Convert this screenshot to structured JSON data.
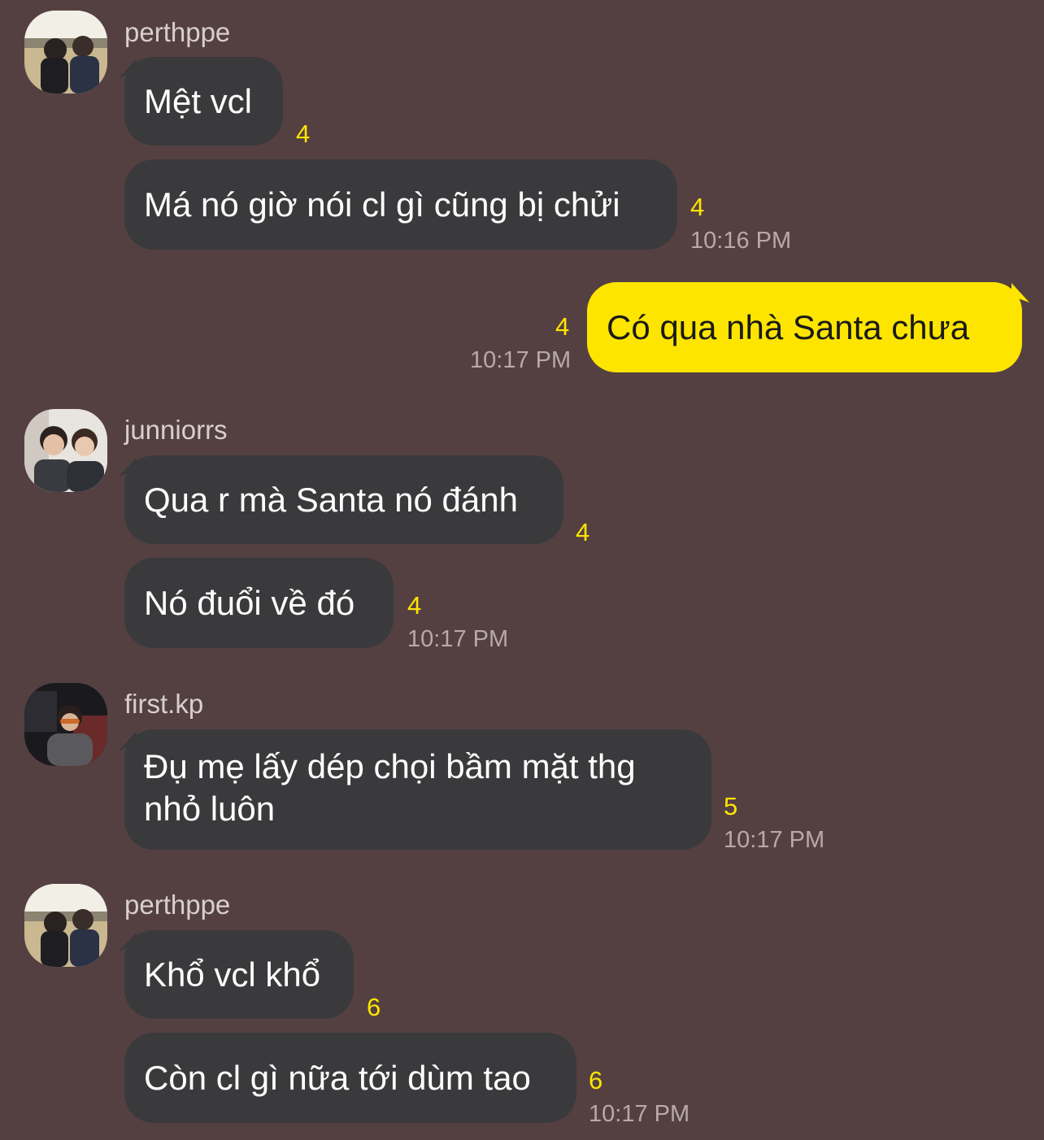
{
  "colors": {
    "background": "#554041",
    "incoming_bubble": "#3a3a3c",
    "outgoing_bubble": "#fee500",
    "unread_count": "#fee500",
    "timestamp": "#b8a9a9",
    "sender_name": "#d8cfcf"
  },
  "groups": [
    {
      "sender": "perthppe",
      "messages": [
        {
          "text": "Mệt vcl",
          "unread": "4",
          "time": ""
        },
        {
          "text": "Má nó giờ nói cl gì cũng bị chửi",
          "unread": "4",
          "time": "10:16 PM"
        }
      ]
    },
    {
      "sender": "me",
      "messages": [
        {
          "text": "Có qua nhà Santa chưa",
          "unread": "4",
          "time": "10:17 PM"
        }
      ]
    },
    {
      "sender": "junniorrs",
      "messages": [
        {
          "text": "Qua r mà Santa nó đánh",
          "unread": "4",
          "time": ""
        },
        {
          "text": "Nó đuổi về đó",
          "unread": "4",
          "time": "10:17 PM"
        }
      ]
    },
    {
      "sender": "first.kp",
      "messages": [
        {
          "text": "Đụ mẹ lấy dép chọi bầm mặt thg nhỏ luôn",
          "unread": "5",
          "time": "10:17 PM"
        }
      ]
    },
    {
      "sender": "perthppe",
      "messages": [
        {
          "text": "Khổ vcl khổ",
          "unread": "6",
          "time": ""
        },
        {
          "text": "Còn cl gì nữa tới dùm tao",
          "unread": "6",
          "time": "10:17 PM"
        }
      ]
    }
  ]
}
